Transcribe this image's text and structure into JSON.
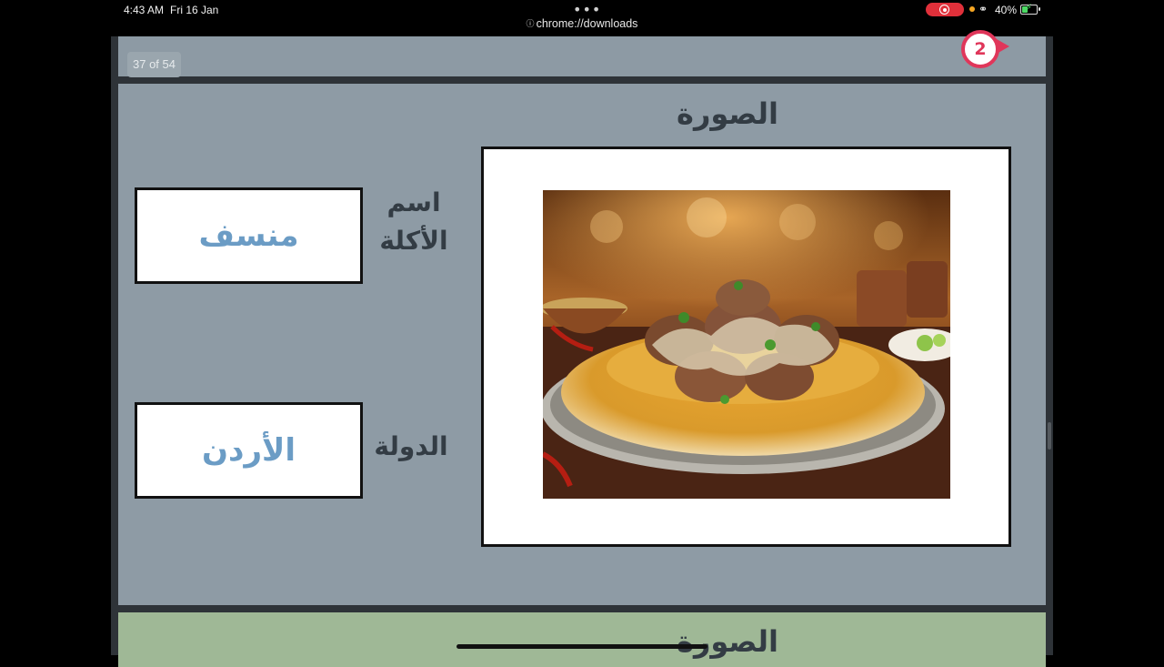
{
  "status_bar": {
    "time": "4:43 AM",
    "date": "Fri 16 Jan",
    "more_icon": "•••",
    "url": "chrome://downloads",
    "battery_percent": "40%",
    "battery_level": 0.4,
    "icons": [
      "screen-record-icon",
      "link-icon",
      "battery-icon"
    ]
  },
  "viewer": {
    "page_counter": "37 of 54",
    "badge_number": "2"
  },
  "slide": {
    "picture_heading": "الصورة",
    "dish_label": "اسم\nالأكلة",
    "dish_value": "منسف",
    "country_label": "الدولة",
    "country_value": "الأردن"
  },
  "next_slide": {
    "heading": "الصورة"
  },
  "colors": {
    "slide_bg": "#8e9ba5",
    "answer_text": "#6b9cc5",
    "badge": "#e0365a",
    "next_slide_bg": "#9fb896"
  }
}
